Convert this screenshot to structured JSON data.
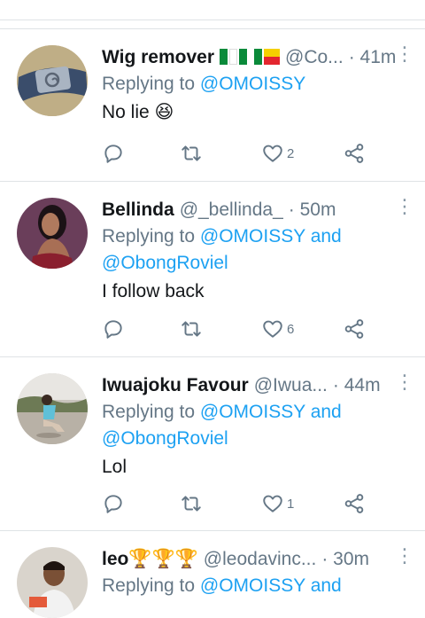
{
  "colors": {
    "link": "#1da1f2",
    "secondary": "#657786",
    "text": "#14171a",
    "divider": "#dfe3e6"
  },
  "tweets": [
    {
      "name": "Wig remover",
      "has_flags": true,
      "handle": "@Co...",
      "time": "· 41m",
      "replying_prefix": "Replying to ",
      "mentions": "@OMOISSY",
      "body": "No lie 😆",
      "likes": "2",
      "avatar": "headband-avatar"
    },
    {
      "name": "Bellinda",
      "has_flags": false,
      "handle": "@_bellinda_",
      "time": "· 50m",
      "replying_prefix": "Replying to ",
      "mentions": "@OMOISSY and",
      "mentions2": "@ObongRoviel",
      "body": "I follow back",
      "likes": "6",
      "avatar": "woman-avatar"
    },
    {
      "name": "Iwuajoku Favour",
      "has_flags": false,
      "handle": "@Iwua...",
      "time": "· 44m",
      "replying_prefix": "Replying to ",
      "mentions": "@OMOISSY and",
      "mentions2": "@ObongRoviel",
      "body": "Lol",
      "likes": "1",
      "avatar": "outdoor-avatar"
    },
    {
      "name": "leo🏆🏆🏆",
      "has_flags": false,
      "handle": "@leodavinc...",
      "time": "· 30m",
      "replying_prefix": "Replying to ",
      "mentions": "@OMOISSY and",
      "avatar": "man-avatar"
    }
  ],
  "icons": {
    "reply": "reply-icon",
    "retweet": "retweet-icon",
    "like": "heart-icon",
    "share": "share-icon",
    "more": "more-vertical-icon"
  }
}
